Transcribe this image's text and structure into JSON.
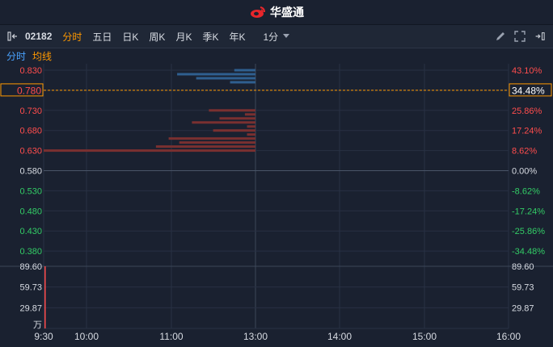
{
  "app": {
    "title": "华盛通",
    "logo_icon": "sina-eye-logo-icon"
  },
  "toolbar": {
    "stock_code": "02182",
    "tabs": [
      {
        "label": "分时",
        "active": true
      },
      {
        "label": "五日",
        "active": false
      },
      {
        "label": "日K",
        "active": false
      },
      {
        "label": "周K",
        "active": false
      },
      {
        "label": "月K",
        "active": false
      },
      {
        "label": "季K",
        "active": false
      },
      {
        "label": "年K",
        "active": false
      }
    ],
    "interval": "1分"
  },
  "subtabs": [
    {
      "label": "分时",
      "color": "#4aa3ff"
    },
    {
      "label": "均线",
      "color": "#ff9900"
    }
  ],
  "chart_data": {
    "type": "line",
    "prev_close": 0.58,
    "price_axis_left": [
      "0.830",
      "0.780",
      "0.730",
      "0.680",
      "0.630",
      "0.580",
      "0.530",
      "0.480",
      "0.430",
      "0.380"
    ],
    "price_axis_right": [
      "43.10%",
      "34.48%",
      "25.86%",
      "17.24%",
      "8.62%",
      "0.00%",
      "-8.62%",
      "-17.24%",
      "-25.86%",
      "-34.48%"
    ],
    "highlight": {
      "price": "0.780",
      "percent": "34.48%"
    },
    "volume_axis": [
      "89.60",
      "59.73",
      "29.87"
    ],
    "volume_unit": "万",
    "time_axis": [
      "9:30",
      "10:00",
      "11:00",
      "13:00",
      "14:00",
      "15:00",
      "16:00"
    ],
    "colors": {
      "up": "#ff4d4d",
      "down": "#33cc66",
      "neutral": "#d7dbe2",
      "accent": "#ff9900",
      "ask_bar": "#2f5f8f",
      "bid_bar": "#7a3030"
    },
    "depth_sell": [
      {
        "price": 0.83,
        "length": 0.1
      },
      {
        "price": 0.82,
        "length": 0.37
      },
      {
        "price": 0.81,
        "length": 0.28
      },
      {
        "price": 0.8,
        "length": 0.12
      }
    ],
    "depth_buy": [
      {
        "price": 0.73,
        "length": 0.22
      },
      {
        "price": 0.72,
        "length": 0.05
      },
      {
        "price": 0.71,
        "length": 0.17
      },
      {
        "price": 0.7,
        "length": 0.3
      },
      {
        "price": 0.69,
        "length": 0.04
      },
      {
        "price": 0.68,
        "length": 0.2
      },
      {
        "price": 0.67,
        "length": 0.04
      },
      {
        "price": 0.66,
        "length": 0.41
      },
      {
        "price": 0.65,
        "length": 0.36
      },
      {
        "price": 0.64,
        "length": 0.47
      },
      {
        "price": 0.63,
        "length": 1.0
      }
    ],
    "volume_bars": [
      {
        "time": "9:30",
        "value": 89.6
      }
    ]
  }
}
